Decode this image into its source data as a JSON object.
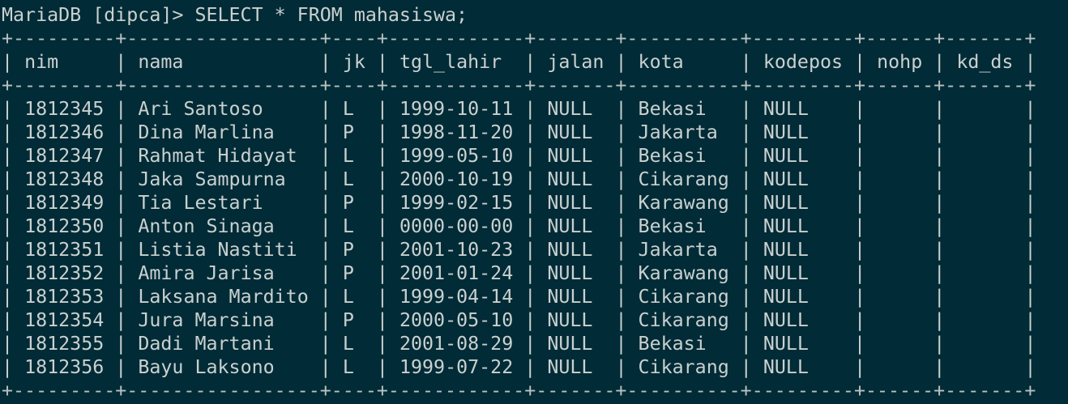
{
  "terminal": {
    "prompt": "MariaDB [dipca]> ",
    "command": "SELECT * FROM mahasiswa;"
  },
  "table": {
    "columns": [
      "nim",
      "nama",
      "jk",
      "tgl_lahir",
      "jalan",
      "kota",
      "kodepos",
      "nohp",
      "kd_ds"
    ],
    "rows": [
      [
        "1812345",
        "Ari Santoso",
        "L",
        "1999-10-11",
        "NULL",
        "Bekasi",
        "NULL",
        "",
        ""
      ],
      [
        "1812346",
        "Dina Marlina",
        "P",
        "1998-11-20",
        "NULL",
        "Jakarta",
        "NULL",
        "",
        ""
      ],
      [
        "1812347",
        "Rahmat Hidayat",
        "L",
        "1999-05-10",
        "NULL",
        "Bekasi",
        "NULL",
        "",
        ""
      ],
      [
        "1812348",
        "Jaka Sampurna",
        "L",
        "2000-10-19",
        "NULL",
        "Cikarang",
        "NULL",
        "",
        ""
      ],
      [
        "1812349",
        "Tia Lestari",
        "P",
        "1999-02-15",
        "NULL",
        "Karawang",
        "NULL",
        "",
        ""
      ],
      [
        "1812350",
        "Anton Sinaga",
        "L",
        "0000-00-00",
        "NULL",
        "Bekasi",
        "NULL",
        "",
        ""
      ],
      [
        "1812351",
        "Listia Nastiti",
        "P",
        "2001-10-23",
        "NULL",
        "Jakarta",
        "NULL",
        "",
        ""
      ],
      [
        "1812352",
        "Amira Jarisa",
        "P",
        "2001-01-24",
        "NULL",
        "Karawang",
        "NULL",
        "",
        ""
      ],
      [
        "1812353",
        "Laksana Mardito",
        "L",
        "1999-04-14",
        "NULL",
        "Cikarang",
        "NULL",
        "",
        ""
      ],
      [
        "1812354",
        "Jura Marsina",
        "P",
        "2000-05-10",
        "NULL",
        "Cikarang",
        "NULL",
        "",
        ""
      ],
      [
        "1812355",
        "Dadi Martani",
        "L",
        "2001-08-29",
        "NULL",
        "Bekasi",
        "NULL",
        "",
        ""
      ],
      [
        "1812356",
        "Bayu Laksono",
        "L",
        "1999-07-22",
        "NULL",
        "Cikarang",
        "NULL",
        "",
        ""
      ]
    ]
  },
  "colors": {
    "background": "#012b36",
    "text": "#c9d1d0"
  }
}
